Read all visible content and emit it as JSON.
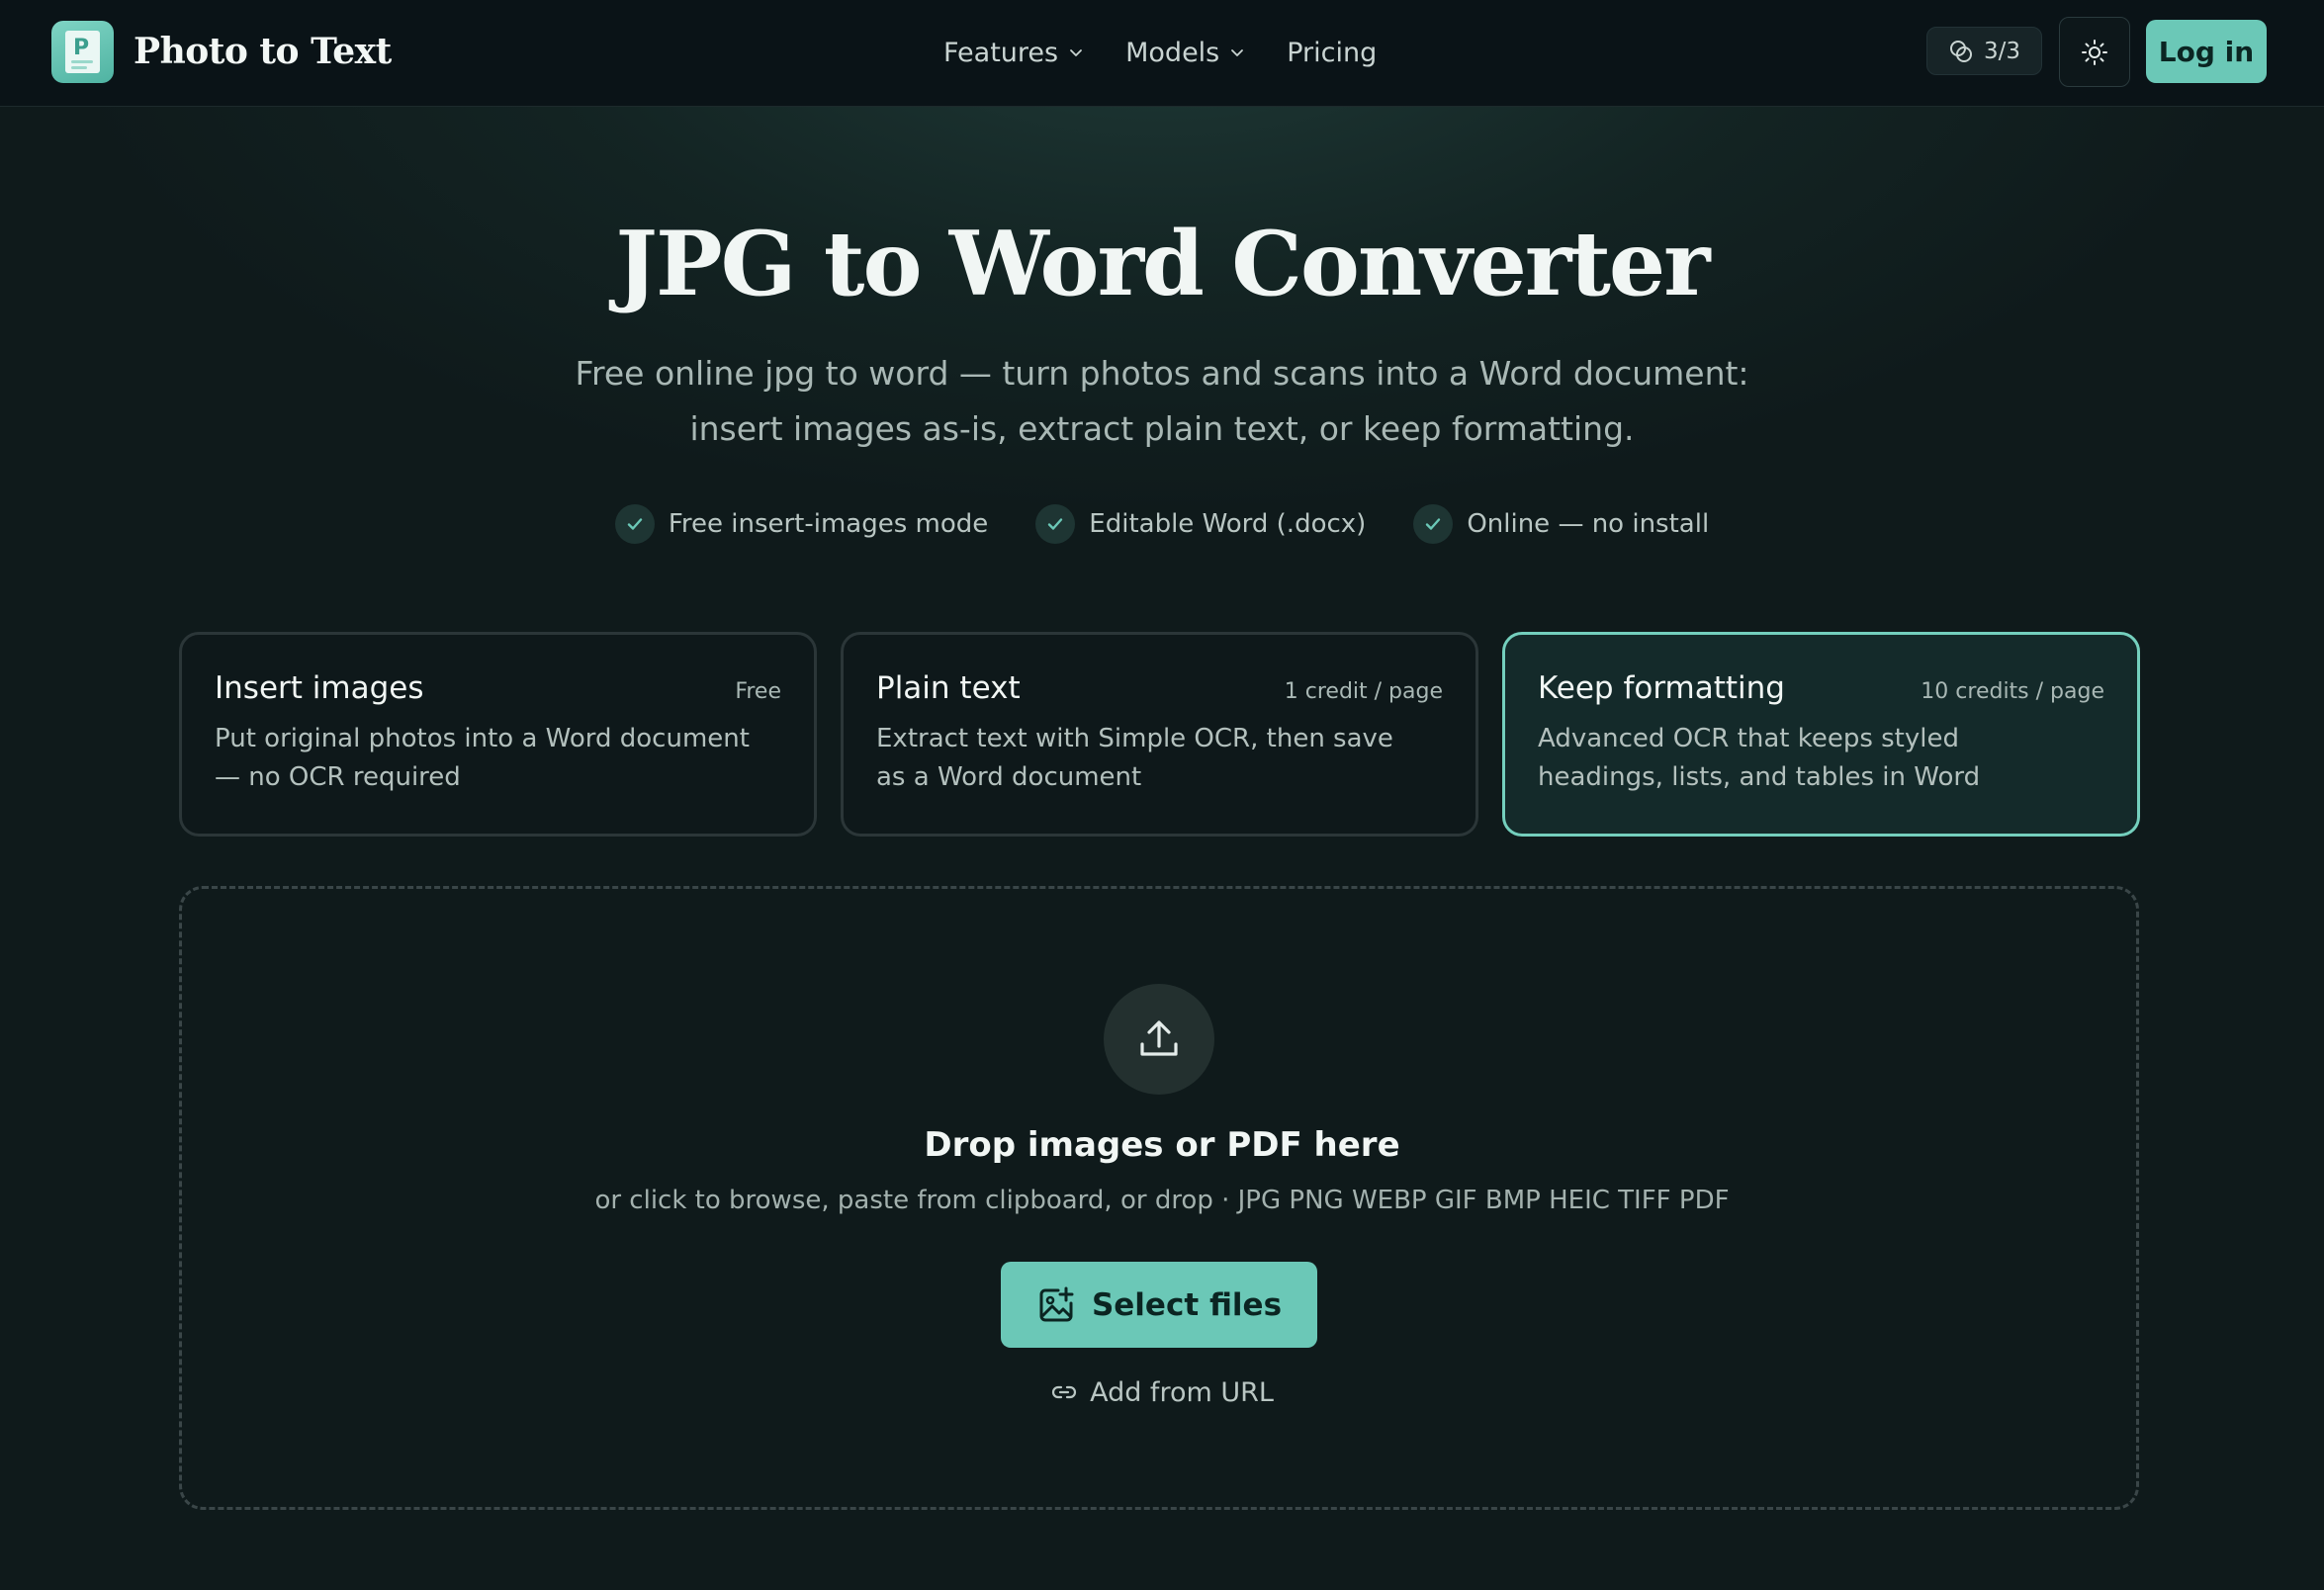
{
  "brand": {
    "name": "Photo to Text",
    "logo_letter": "P"
  },
  "nav": {
    "items": [
      {
        "label": "Features",
        "has_dropdown": true
      },
      {
        "label": "Models",
        "has_dropdown": true
      },
      {
        "label": "Pricing",
        "has_dropdown": false
      }
    ],
    "credits": "3/3",
    "login_label": "Log in"
  },
  "hero": {
    "title": "JPG to Word Converter",
    "subtitle": "Free online jpg to word — turn photos and scans into a Word document: insert images as-is, extract plain text, or keep formatting.",
    "features": [
      "Free insert-images mode",
      "Editable Word (.docx)",
      "Online — no install"
    ]
  },
  "modes": [
    {
      "title": "Insert images",
      "price": "Free",
      "description": "Put original photos into a Word document — no OCR required",
      "selected": false
    },
    {
      "title": "Plain text",
      "price": "1 credit / page",
      "description": "Extract text with Simple OCR, then save as a Word document",
      "selected": false
    },
    {
      "title": "Keep formatting",
      "price": "10 credits / page",
      "description": "Advanced OCR that keeps styled headings, lists, and tables in Word",
      "selected": true
    }
  ],
  "dropzone": {
    "title": "Drop images or PDF here",
    "subtitle": "or click to browse, paste from clipboard, or drop · JPG PNG WEBP GIF BMP HEIC TIFF PDF",
    "select_label": "Select files",
    "url_label": "Add from URL"
  },
  "colors": {
    "accent": "#6bc8b7",
    "background": "#0f1a1b",
    "nav_background": "#0a1317",
    "selected_border": "#74cfbd"
  },
  "icons": [
    "chevron-down-icon",
    "credits-icon",
    "sun-icon",
    "check-icon",
    "upload-icon",
    "add-image-icon",
    "link-icon"
  ]
}
